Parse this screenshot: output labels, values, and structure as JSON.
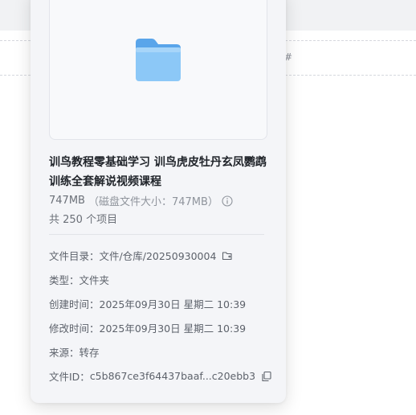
{
  "background": {
    "fragment_text": "#"
  },
  "popup": {
    "preview": {
      "icon": "folder-icon"
    },
    "title": "训鸟教程零基础学习 训鸟虎皮牡丹玄凤鹦鹉训练全套解说视频课程",
    "size": "747MB",
    "size_detail": "（磁盘文件大小：747MB）",
    "item_count": "共 250 个项目",
    "meta": {
      "directory_label": "文件目录：",
      "directory_value": "文件/仓库/20250930004",
      "type_label": "类型：",
      "type_value": "文件夹",
      "created_label": "创建时间：",
      "created_value": "2025年09月30日 星期二 10:39",
      "modified_label": "修改时间：",
      "modified_value": "2025年09月30日 星期二 10:39",
      "source_label": "来源：",
      "source_value": "转存",
      "file_id_label": "文件ID：",
      "file_id_value": "c5b867ce3f64437baaf...c20ebb3"
    }
  },
  "colors": {
    "folder_top": "#5aa5ea",
    "folder_front": "#8cc8f7",
    "popup_bg": "#f4f5f8"
  }
}
